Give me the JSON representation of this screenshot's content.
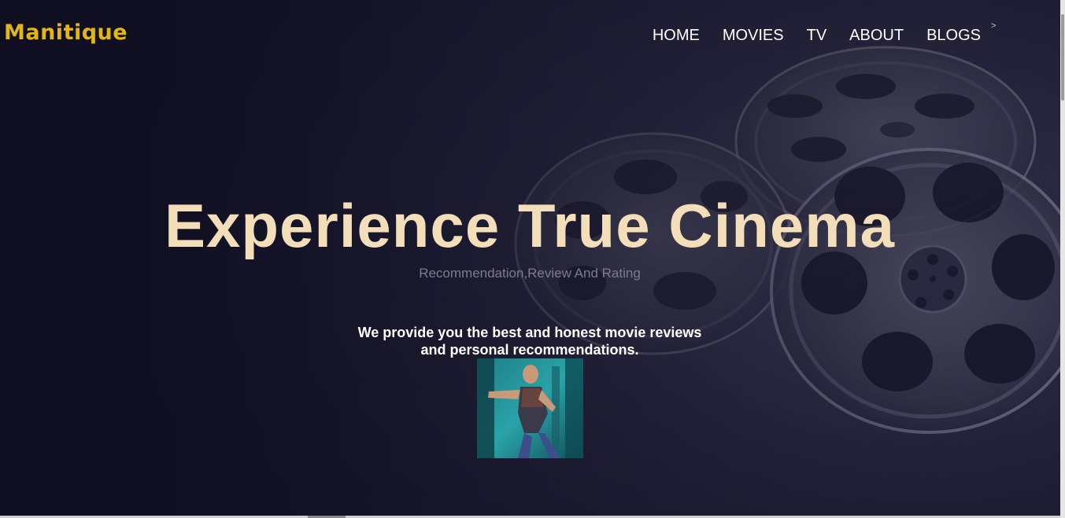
{
  "brand": {
    "logo_text": "Manitique",
    "accent_color": "#e3b613"
  },
  "nav": {
    "items": [
      {
        "label": "HOME"
      },
      {
        "label": "MOVIES"
      },
      {
        "label": "TV"
      },
      {
        "label": "ABOUT"
      },
      {
        "label": "BLOGS"
      }
    ],
    "caret": ">"
  },
  "hero": {
    "title": "Experience True Cinema",
    "title_color": "#f3deba",
    "subtitle": "Recommendation,Review And Rating",
    "description_line1": "We provide you the best and honest movie reviews",
    "description_line2": "and personal recommendations."
  },
  "background": {
    "icon": "film-reel-icon"
  }
}
